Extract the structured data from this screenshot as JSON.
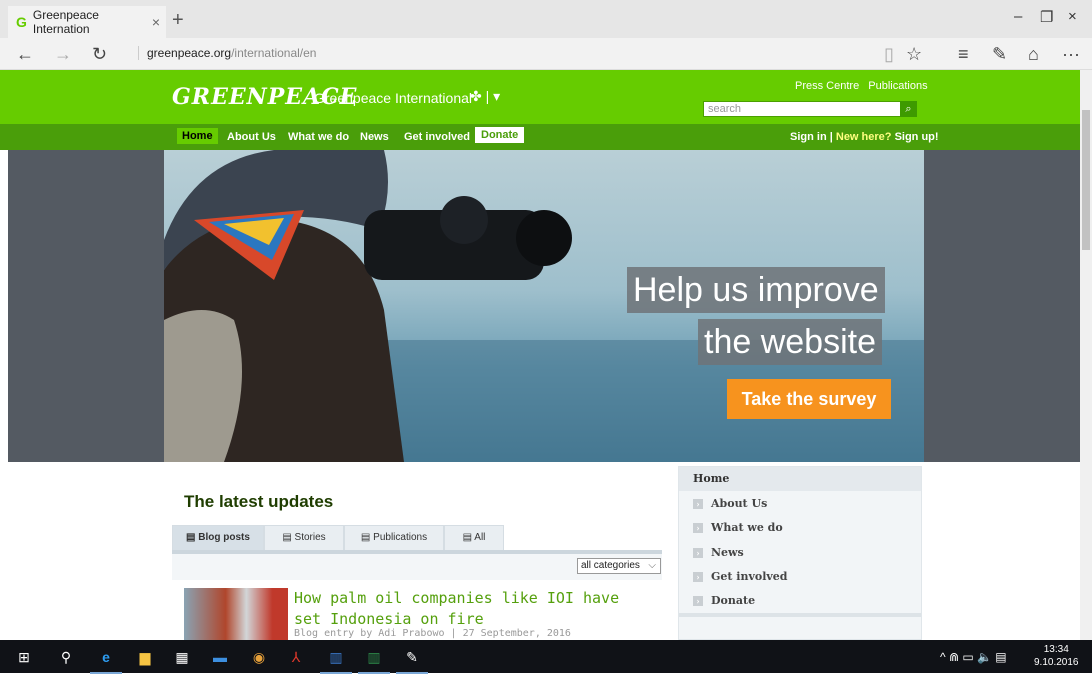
{
  "browser": {
    "tab_title": "Greenpeace Internation",
    "tab_close": "×",
    "new_tab": "+",
    "url_domain": "greenpeace.org",
    "url_path": "/international/en",
    "win_minimize": "–",
    "win_maximize": "❐",
    "win_close": "×",
    "nav_back": "←",
    "nav_forward": "→",
    "nav_refresh": "↻",
    "reading_view": "▯",
    "favorite": "☆",
    "hub": "≡",
    "notes": "✎",
    "share": "⌂",
    "more": "···"
  },
  "site": {
    "logo": "GREENPEACE",
    "name": "Greenpeace International",
    "globe_glyph": "✤ | ▾",
    "top_links": [
      "Press Centre",
      "Publications"
    ],
    "search_placeholder": "search",
    "search_button": "🔍",
    "menu": {
      "home": "Home",
      "items": [
        "About Us",
        "What we do",
        "News",
        "Get involved"
      ],
      "donate": "Donate"
    },
    "signin": {
      "sign_in": "Sign in",
      "sep": " | ",
      "new_here": "New here?",
      "sign_up": " Sign up!"
    },
    "hero": {
      "line1": "Help us improve",
      "line2": "the website",
      "button": "Take the survey"
    },
    "latest": {
      "title": "The latest updates",
      "tabs": [
        "Blog posts",
        "Stories",
        "Publications",
        "All"
      ],
      "filter": "all categories",
      "post": {
        "title": "How palm oil companies like IOI have set Indonesia on fire",
        "meta": "Blog entry by Adi Prabowo | 27 September, 2016"
      }
    },
    "sidebar": {
      "home": "Home",
      "items": [
        "About Us",
        "What we do",
        "News",
        "Get involved",
        "Donate"
      ]
    }
  },
  "taskbar": {
    "clock_time": "13:34",
    "clock_date": "9.10.2016",
    "tray": "^  ⋒  ▭  🔈  ▤"
  },
  "colors": {
    "greenpeace_green": "#66cc00",
    "menu_green": "#4a9e0a",
    "survey_orange": "#f7931e"
  }
}
